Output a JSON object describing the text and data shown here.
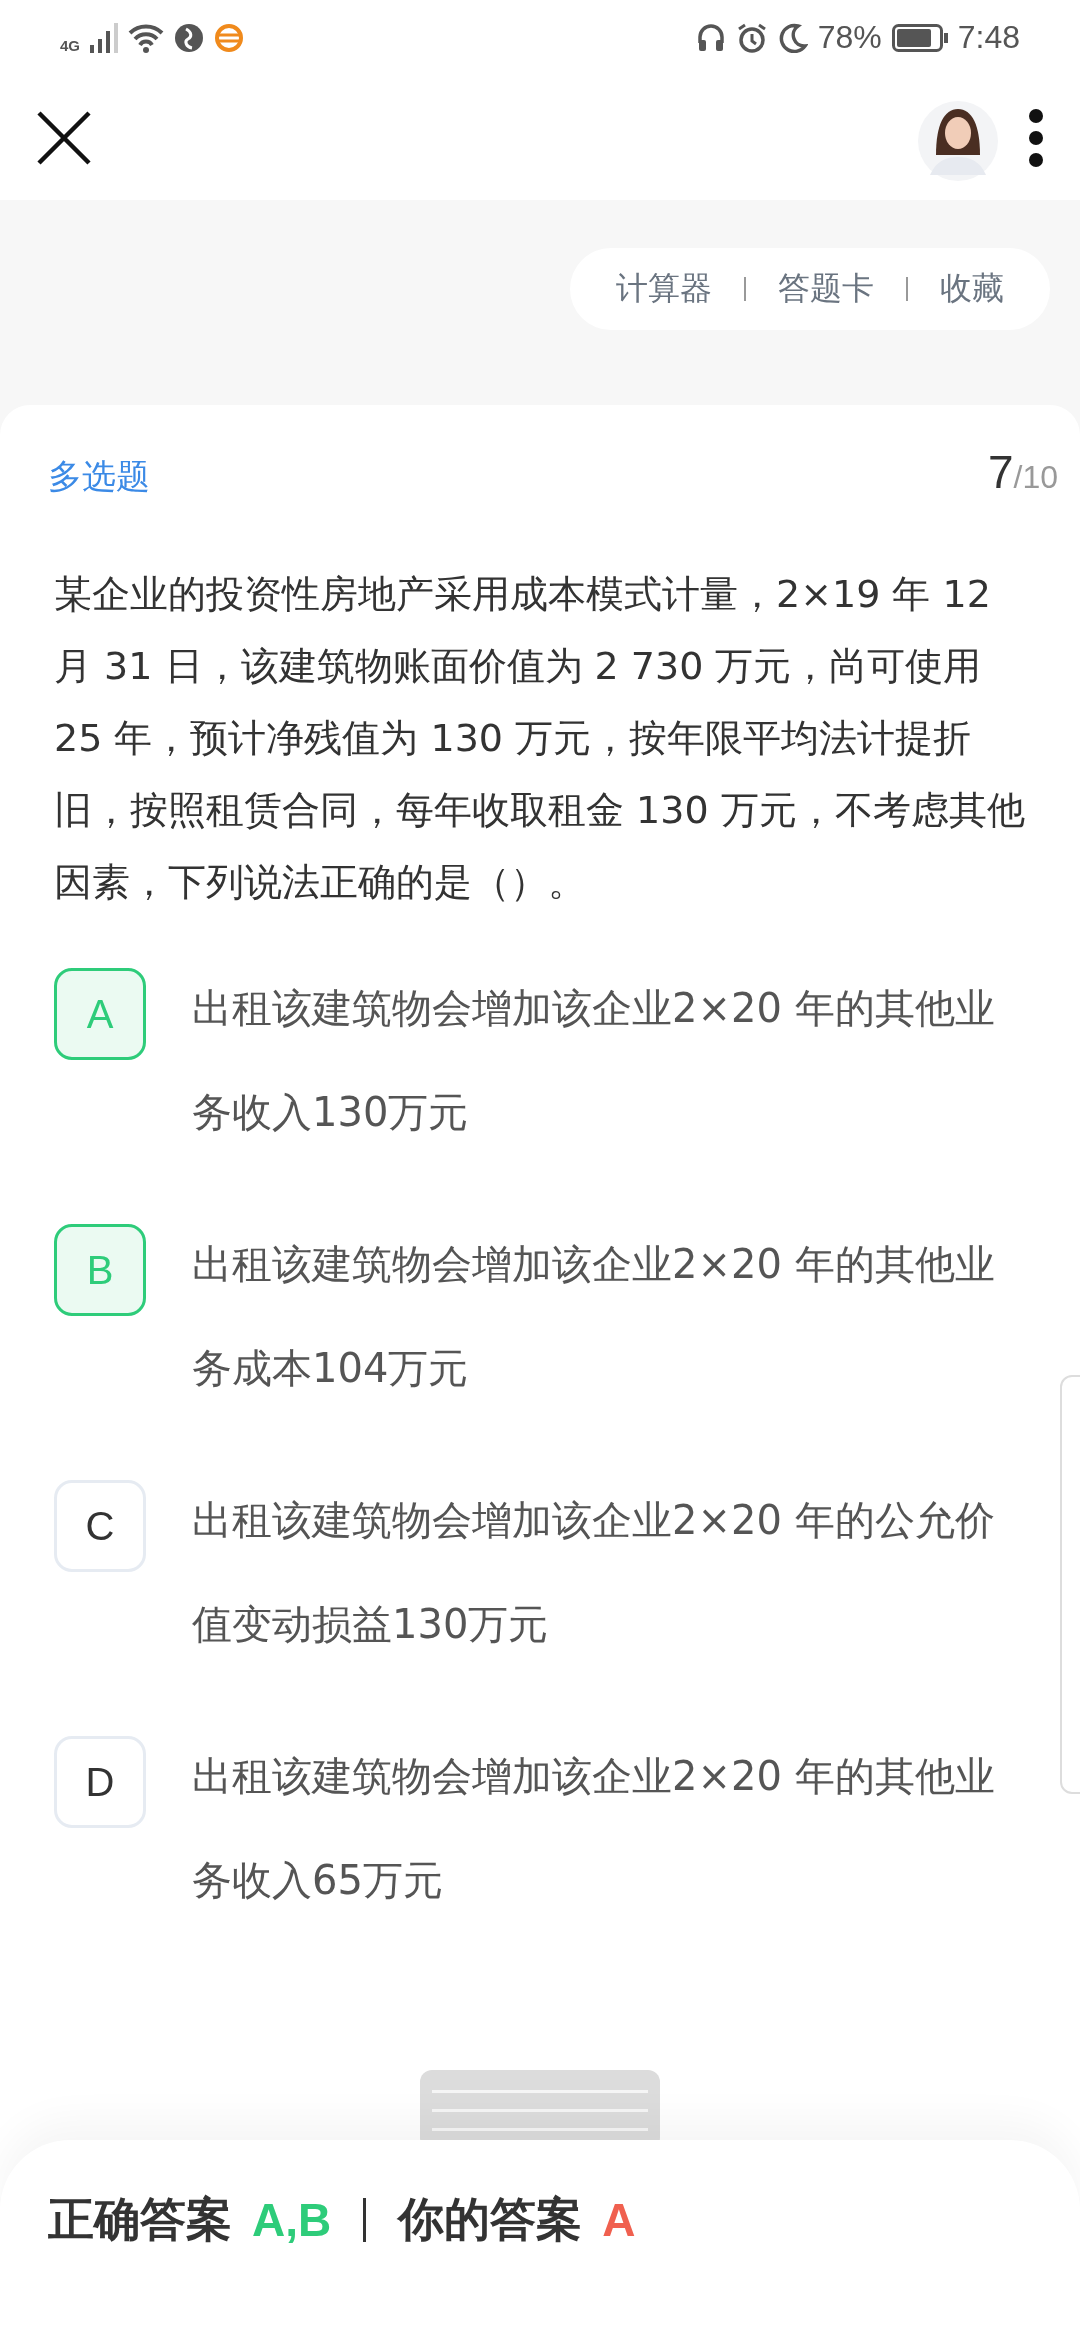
{
  "status_bar": {
    "network": "4G",
    "battery": "78%",
    "time": "7:48"
  },
  "toolbar": {
    "items": [
      "计算器",
      "答题卡",
      "收藏"
    ]
  },
  "question": {
    "type": "多选题",
    "current": "7",
    "total": "/10",
    "text": "某企业的投资性房地产采用成本模式计量，2×19 年 12 月 31 日，该建筑物账面价值为 2 730 万元，尚可使用 25 年，预计净残值为 130 万元，按年限平均法计提折旧，按照租赁合同，每年收取租金 130 万元，不考虑其他因素，下列说法正确的是（）。"
  },
  "options": [
    {
      "letter": "A",
      "text": "出租该建筑物会增加该企业2×20 年的其他业务收入130万元",
      "highlighted": true
    },
    {
      "letter": "B",
      "text": "出租该建筑物会增加该企业2×20 年的其他业务成本104万元",
      "highlighted": true
    },
    {
      "letter": "C",
      "text": "出租该建筑物会增加该企业2×20 年的公允价值变动损益130万元",
      "highlighted": false
    },
    {
      "letter": "D",
      "text": "出租该建筑物会增加该企业2×20 年的其他业务收入65万元",
      "highlighted": false
    }
  ],
  "answer": {
    "correct_label": "正确答案",
    "correct": "A,B",
    "yours_label": "你的答案",
    "yours": "A"
  }
}
